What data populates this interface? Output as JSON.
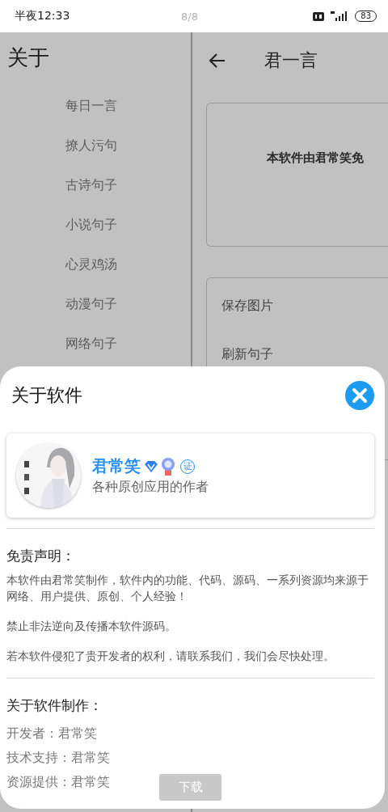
{
  "status_bar": {
    "time": "半夜12:33",
    "page_indicator": "8/8",
    "battery": "83"
  },
  "left_panel": {
    "title": "关于",
    "items": [
      {
        "label": "每日一言"
      },
      {
        "label": "撩人污句"
      },
      {
        "label": "古诗句子"
      },
      {
        "label": "小说句子"
      },
      {
        "label": "心灵鸡汤"
      },
      {
        "label": "动漫句子"
      },
      {
        "label": "网络句子"
      }
    ]
  },
  "right_panel": {
    "title": "君一言",
    "intro": "本软件由君常笑免",
    "actions": [
      {
        "label": "保存图片"
      },
      {
        "label": "刷新句子"
      }
    ]
  },
  "sheet": {
    "title": "关于软件",
    "profile": {
      "name": "君常笑",
      "badge": "证",
      "subtitle": "各种原创应用的作者"
    },
    "disclaimer": {
      "heading": "免责声明：",
      "paragraphs": [
        "本软件由君常笑制作，软件内的功能、代码、源码、一系列资源均来源于网络、用户提供、原创、个人经验！",
        "禁止非法逆向及传播本软件源码。",
        "若本软件侵犯了贵开发者的权利，请联系我们，我们会尽快处理。"
      ]
    },
    "credits": {
      "heading": "关于软件制作：",
      "lines": [
        "开发者：君常笑",
        "技术支持：君常笑",
        "资源提供：君常笑"
      ]
    },
    "download_button": "下载"
  }
}
